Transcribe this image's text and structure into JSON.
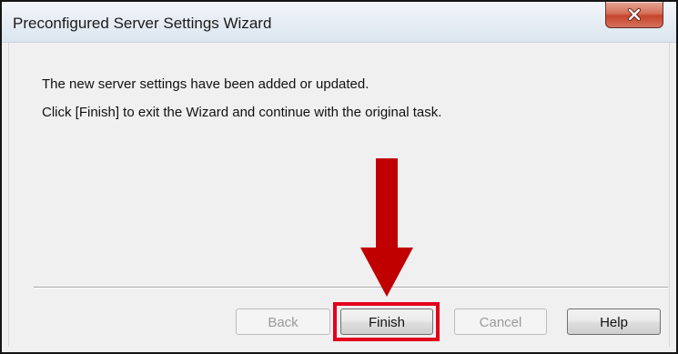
{
  "window": {
    "title": "Preconfigured Server Settings Wizard",
    "close_icon": "close-icon"
  },
  "message": {
    "line1": "The new server settings have been added or updated.",
    "line2": "Click [Finish] to exit the Wizard and continue with the original task."
  },
  "buttons": {
    "back": "Back",
    "finish": "Finish",
    "cancel": "Cancel",
    "help": "Help"
  },
  "annotation": {
    "arrow_icon": "arrow-down-icon",
    "color": "#c00000",
    "highlight_color": "#e3001b"
  }
}
